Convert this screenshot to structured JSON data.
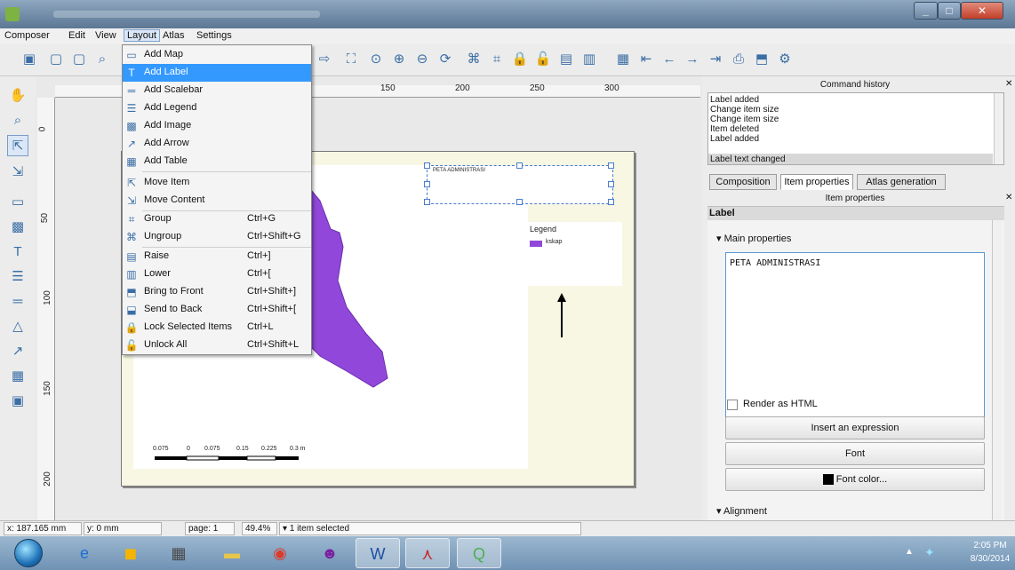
{
  "title_bar": {
    "title": ""
  },
  "menubar": {
    "items": [
      "Composer",
      "Edit",
      "View",
      "Layout",
      "Atlas",
      "Settings"
    ]
  },
  "layout_menu": {
    "items": [
      {
        "label": "Add Map",
        "shortcut": "",
        "icon": "add-map-icon"
      },
      {
        "label": "Add Label",
        "shortcut": "",
        "icon": "add-label-icon"
      },
      {
        "label": "Add Scalebar",
        "shortcut": "",
        "icon": "add-scalebar-icon"
      },
      {
        "label": "Add Legend",
        "shortcut": "",
        "icon": "add-legend-icon"
      },
      {
        "label": "Add Image",
        "shortcut": "",
        "icon": "add-image-icon"
      },
      {
        "label": "Add Arrow",
        "shortcut": "",
        "icon": "add-arrow-icon"
      },
      {
        "label": "Add Table",
        "shortcut": "",
        "icon": "add-table-icon"
      },
      {
        "label": "Move Item",
        "shortcut": "",
        "icon": "move-item-icon"
      },
      {
        "label": "Move Content",
        "shortcut": "",
        "icon": "move-content-icon"
      },
      {
        "label": "Group",
        "shortcut": "Ctrl+G",
        "icon": "group-icon"
      },
      {
        "label": "Ungroup",
        "shortcut": "Ctrl+Shift+G",
        "icon": "ungroup-icon"
      },
      {
        "label": "Raise",
        "shortcut": "Ctrl+]",
        "icon": "raise-icon"
      },
      {
        "label": "Lower",
        "shortcut": "Ctrl+[",
        "icon": "lower-icon"
      },
      {
        "label": "Bring to Front",
        "shortcut": "Ctrl+Shift+]",
        "icon": "bring-to-front-icon"
      },
      {
        "label": "Send to Back",
        "shortcut": "Ctrl+Shift+[",
        "icon": "send-to-back-icon"
      },
      {
        "label": "Lock Selected Items",
        "shortcut": "Ctrl+L",
        "icon": "lock-icon"
      },
      {
        "label": "Unlock All",
        "shortcut": "Ctrl+Shift+L",
        "icon": "unlock-icon"
      }
    ],
    "highlighted": "Add Label"
  },
  "ruler": {
    "h_labels": [
      "150",
      "200",
      "250",
      "300"
    ],
    "v_labels": [
      "0",
      "50",
      "100",
      "150",
      "200"
    ]
  },
  "canvas": {
    "label_text": "PETA ADMINISTRASI",
    "legend": {
      "title": "Legend",
      "item": "kskap"
    },
    "scalebar_labels": [
      "0.075",
      "0",
      "0.075",
      "0.15",
      "0.225",
      "0.3 m"
    ]
  },
  "command_history": {
    "header": "Command history",
    "items": [
      "Label added",
      "Change item size",
      "Change item size",
      "Item deleted",
      "Label added",
      "Label text changed"
    ],
    "selected": "Label text changed"
  },
  "tabs": [
    "Composition",
    "Item properties",
    "Atlas generation"
  ],
  "item_properties": {
    "header": "Item properties",
    "section": "Label",
    "main_properties": "Main properties",
    "text_value": "PETA ADMINISTRASI",
    "render_html": "Render as HTML",
    "insert_expression": "Insert an expression",
    "font": "Font",
    "font_color": "Font color...",
    "alignment": "Alignment"
  },
  "status": {
    "x": "x: 187.165 mm",
    "y": "y: 0 mm",
    "page": "page: 1",
    "zoom": "49.4%",
    "selection": "1 item selected"
  },
  "taskbar": {
    "apps": [
      "ie-icon",
      "outlook-icon",
      "calendar-icon",
      "explorer-icon",
      "chrome-icon",
      "yahoo-icon",
      "word-icon",
      "acrobat-icon",
      "qgis-icon"
    ],
    "time": "2:05 PM",
    "date": "8/30/2014"
  },
  "colors": {
    "menu_highlight": "#3399ff",
    "map_fill": "#9147d9",
    "page_bg": "#f7f7e3"
  }
}
